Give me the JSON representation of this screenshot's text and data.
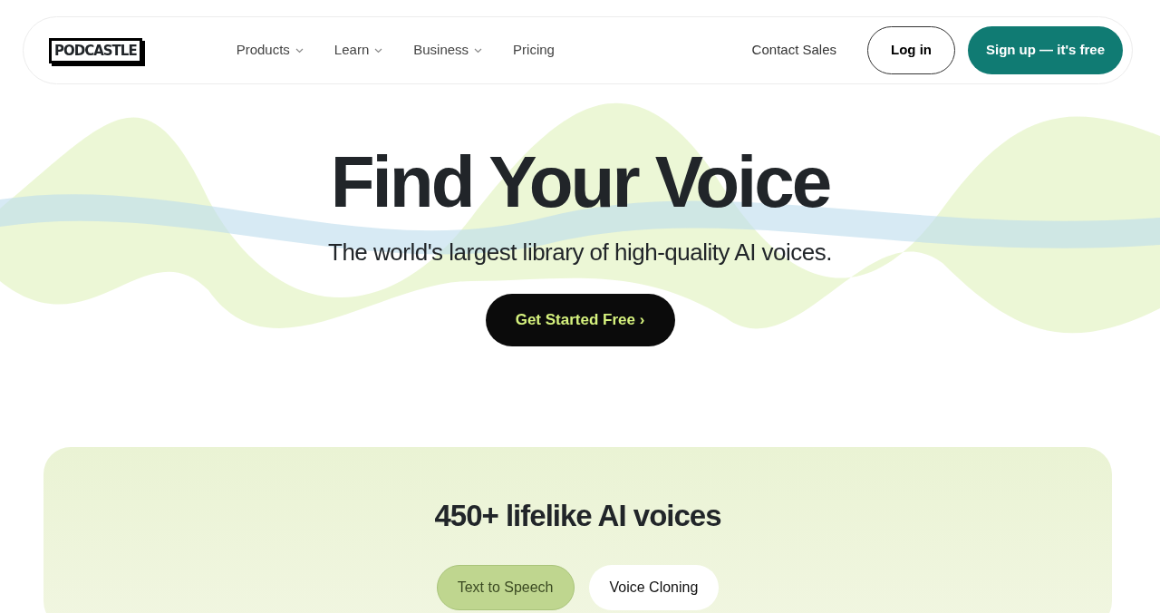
{
  "header": {
    "logo": "PODCASTLE",
    "nav": [
      {
        "label": "Products",
        "has_menu": true
      },
      {
        "label": "Learn",
        "has_menu": true
      },
      {
        "label": "Business",
        "has_menu": true
      },
      {
        "label": "Pricing",
        "has_menu": false
      }
    ],
    "contact": "Contact Sales",
    "login": "Log in",
    "signup": "Sign up — it's free"
  },
  "hero": {
    "title": "Find Your Voice",
    "subtitle": "The world's largest library of high-quality AI voices.",
    "cta": "Get Started Free",
    "cta_chevron": "›"
  },
  "voices": {
    "heading": "450+ lifelike AI voices",
    "tabs": [
      {
        "label": "Text to Speech",
        "selected": true
      },
      {
        "label": "Voice Cloning",
        "selected": false
      }
    ]
  }
}
